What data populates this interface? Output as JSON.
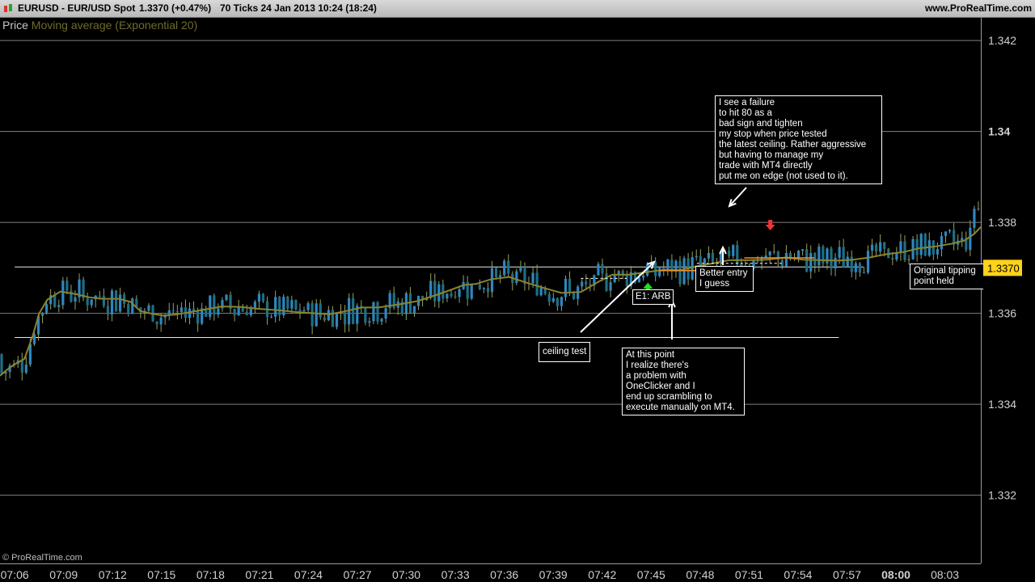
{
  "titlebar": {
    "symbol": "EURUSD - EUR/USD Spot",
    "price_info": "1.3370 (+0.47%)",
    "tick_info": "70 Ticks  24 Jan 2013 10:24 (18:24)",
    "site": "www.ProRealTime.com"
  },
  "legend": {
    "price": "Price",
    "ma": "Moving average (Exponential 20)"
  },
  "copyright": "© ProRealTime.com",
  "colors": {
    "background": "#000000",
    "candle_up": "#2e86c1",
    "candle_down": "#1e6f83",
    "ema": "#8a842e",
    "current_price_bg": "#ffd21a",
    "grid": "#808080",
    "orange_line": "#f09020",
    "arrow_up": "#22dd22",
    "arrow_down": "#ee3333"
  },
  "annotations": [
    "I see a failure\nto hit 80 as a\nbad sign and tighten\nmy stop when price tested\nthe latest ceiling. Rather aggressive\nbut having to manage my\ntrade with MT4 directly\nput me on edge (not used to it).",
    "Better entry\nI guess",
    "Original tipping\npoint held",
    "E1: ARB",
    "ceiling test",
    "At this point\nI realize there's\na problem with\nOneClicker and I\nend up scrambling to\nexecute manually on MT4."
  ],
  "chart_data": {
    "type": "candlestick",
    "title": "EURUSD - EUR/USD Spot",
    "series": [
      {
        "name": "Price"
      },
      {
        "name": "Moving average (Exponential 20)"
      }
    ],
    "ylim": [
      1.3305,
      1.3425
    ],
    "y_ticks": [
      1.332,
      1.334,
      1.336,
      1.338,
      1.34,
      1.342
    ],
    "y_tick_labels": [
      "1.332",
      "1.334",
      "1.336",
      "1.338",
      "1.34",
      "1.342"
    ],
    "y_tick_bold": [
      false,
      false,
      false,
      false,
      true,
      false
    ],
    "x_labels": [
      "07:06",
      "07:09",
      "07:12",
      "07:15",
      "07:18",
      "07:21",
      "07:24",
      "07:27",
      "07:30",
      "07:33",
      "07:36",
      "07:39",
      "07:42",
      "07:45",
      "07:48",
      "07:51",
      "07:54",
      "07:57",
      "08:00",
      "08:03"
    ],
    "x_label_minutes": [
      426,
      429,
      432,
      435,
      438,
      441,
      444,
      447,
      450,
      453,
      456,
      459,
      462,
      465,
      468,
      471,
      474,
      477,
      480,
      483
    ],
    "x_label_bold": [
      false,
      false,
      false,
      false,
      false,
      false,
      false,
      false,
      false,
      false,
      false,
      false,
      false,
      false,
      false,
      false,
      false,
      false,
      true,
      false
    ],
    "x_range_minutes": [
      425.1,
      485.2
    ],
    "current_price": 1.337,
    "current_price_label": "1.3370",
    "horizontal_lines": [
      {
        "y": 1.33702,
        "from": 426.0,
        "to": 478.0
      },
      {
        "y": 1.33547,
        "from": 426.0,
        "to": 476.5
      }
    ],
    "ema_points": [
      [
        425.1,
        1.33463
      ],
      [
        425.6,
        1.33478
      ],
      [
        426.0,
        1.33488
      ],
      [
        426.6,
        1.335
      ],
      [
        427.1,
        1.3355
      ],
      [
        427.5,
        1.336
      ],
      [
        428.0,
        1.3363
      ],
      [
        428.8,
        1.33648
      ],
      [
        429.8,
        1.33642
      ],
      [
        430.6,
        1.33635
      ],
      [
        431.4,
        1.33632
      ],
      [
        432.4,
        1.33632
      ],
      [
        433.1,
        1.33625
      ],
      [
        433.7,
        1.33605
      ],
      [
        434.3,
        1.336
      ],
      [
        435.1,
        1.33595
      ],
      [
        435.8,
        1.33597
      ],
      [
        436.8,
        1.33603
      ],
      [
        437.9,
        1.3361
      ],
      [
        438.7,
        1.33615
      ],
      [
        439.9,
        1.33614
      ],
      [
        440.9,
        1.3361
      ],
      [
        442.1,
        1.33607
      ],
      [
        443.2,
        1.33603
      ],
      [
        444.4,
        1.336
      ],
      [
        445.3,
        1.33598
      ],
      [
        446.3,
        1.33605
      ],
      [
        447.3,
        1.33613
      ],
      [
        448.3,
        1.33613
      ],
      [
        449.6,
        1.3362
      ],
      [
        450.7,
        1.33627
      ],
      [
        451.8,
        1.3364
      ],
      [
        452.6,
        1.3365
      ],
      [
        453.5,
        1.33662
      ],
      [
        454.3,
        1.33665
      ],
      [
        455.2,
        1.33675
      ],
      [
        456.3,
        1.3368
      ],
      [
        457.4,
        1.33667
      ],
      [
        458.5,
        1.33655
      ],
      [
        459.5,
        1.33645
      ],
      [
        460.7,
        1.33647
      ],
      [
        461.8,
        1.3367
      ],
      [
        462.6,
        1.33685
      ],
      [
        463.6,
        1.33685
      ],
      [
        464.6,
        1.3369
      ],
      [
        465.8,
        1.33696
      ],
      [
        466.8,
        1.33695
      ],
      [
        467.7,
        1.33703
      ],
      [
        468.8,
        1.3371
      ],
      [
        469.8,
        1.33717
      ],
      [
        470.9,
        1.33717
      ],
      [
        472.1,
        1.33718
      ],
      [
        473.3,
        1.33723
      ],
      [
        474.3,
        1.33718
      ],
      [
        475.3,
        1.33717
      ],
      [
        476.4,
        1.33716
      ],
      [
        477.4,
        1.33718
      ],
      [
        478.4,
        1.33723
      ],
      [
        479.4,
        1.3373
      ],
      [
        480.5,
        1.33735
      ],
      [
        481.4,
        1.33743
      ],
      [
        482.4,
        1.33747
      ],
      [
        483.4,
        1.33753
      ],
      [
        484.2,
        1.3376
      ],
      [
        484.8,
        1.33775
      ],
      [
        485.2,
        1.3379
      ]
    ],
    "orange_line": {
      "y": 1.33694,
      "from": 465.5,
      "to": 470.7
    },
    "orange_line_2": {
      "y": 1.33722,
      "from": 470.7,
      "to": 475.0
    },
    "dashed_lines": [
      {
        "y": 1.3371,
        "from": 467.8,
        "to": 473.0
      },
      {
        "y": 1.33677,
        "from": 460.7,
        "to": 463.5
      }
    ],
    "markers": [
      {
        "type": "arrow-up",
        "color": "green",
        "x": 464.8,
        "y": 1.33655
      },
      {
        "type": "arrow-down",
        "color": "red",
        "x": 472.3,
        "y": 1.33795
      }
    ]
  }
}
